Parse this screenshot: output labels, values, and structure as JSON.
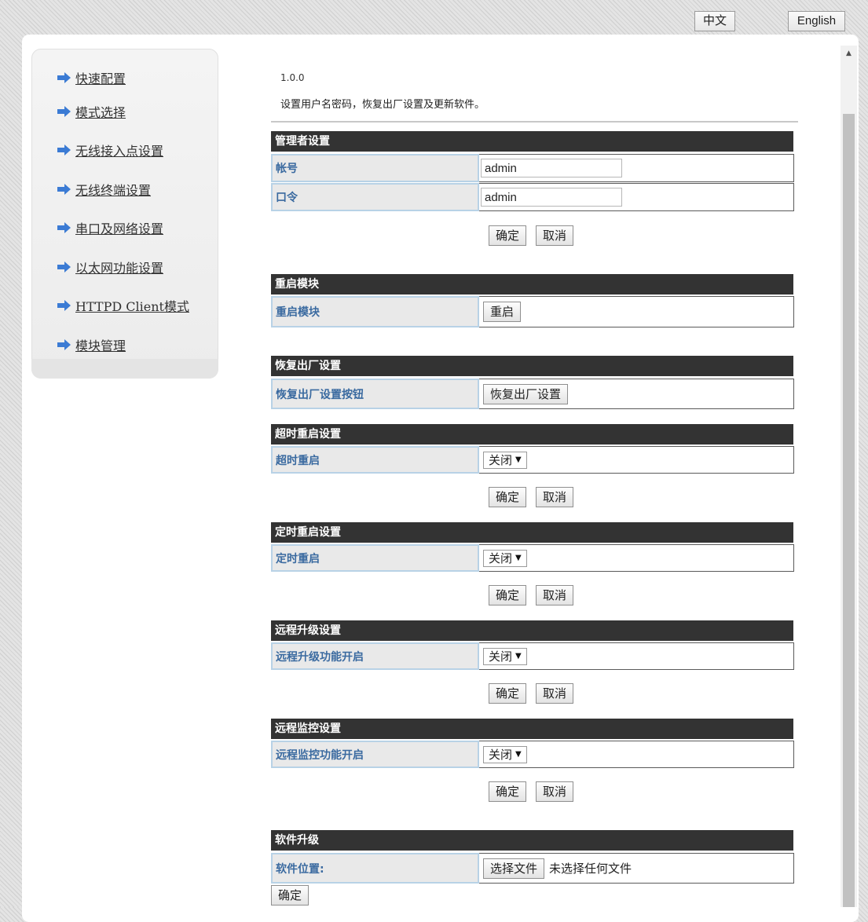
{
  "lang": {
    "zh": "中文",
    "en": "English"
  },
  "nav": [
    {
      "label": "快速配置"
    },
    {
      "label": "模式选择"
    },
    {
      "label": "无线接入点设置"
    },
    {
      "label": "无线终端设置"
    },
    {
      "label": "串口及网络设置"
    },
    {
      "label": "以太网功能设置"
    },
    {
      "label": "HTTPD Client模式"
    },
    {
      "label": "模块管理"
    }
  ],
  "colors": {
    "nav_arrow": "#3b7bd4",
    "section_header": "#333333",
    "label_text": "#3a6aa0"
  },
  "page": {
    "version": "1.0.0",
    "description": "设置用户名密码，恢复出厂设置及更新软件。"
  },
  "admin": {
    "header": "管理者设置",
    "account_label": "帐号",
    "account_value": "admin",
    "password_label": "口令",
    "password_value": "admin",
    "confirm": "确定",
    "cancel": "取消"
  },
  "restart": {
    "header": "重启模块",
    "label": "重启模块",
    "button": "重启"
  },
  "factory": {
    "header": "恢复出厂设置",
    "label": "恢复出厂设置按钮",
    "button": "恢复出厂设置"
  },
  "timeout_restart": {
    "header": "超时重启设置",
    "label": "超时重启",
    "value": "关闭",
    "confirm": "确定",
    "cancel": "取消"
  },
  "timed_restart": {
    "header": "定时重启设置",
    "label": "定时重启",
    "value": "关闭",
    "confirm": "确定",
    "cancel": "取消"
  },
  "remote_upgrade": {
    "header": "远程升级设置",
    "label": "远程升级功能开启",
    "value": "关闭",
    "confirm": "确定",
    "cancel": "取消"
  },
  "remote_monitor": {
    "header": "远程监控设置",
    "label": "远程监控功能开启",
    "value": "关闭",
    "confirm": "确定",
    "cancel": "取消"
  },
  "software": {
    "header": "软件升级",
    "label": "软件位置:",
    "choose": "选择文件",
    "no_file": "未选择任何文件",
    "confirm": "确定"
  }
}
